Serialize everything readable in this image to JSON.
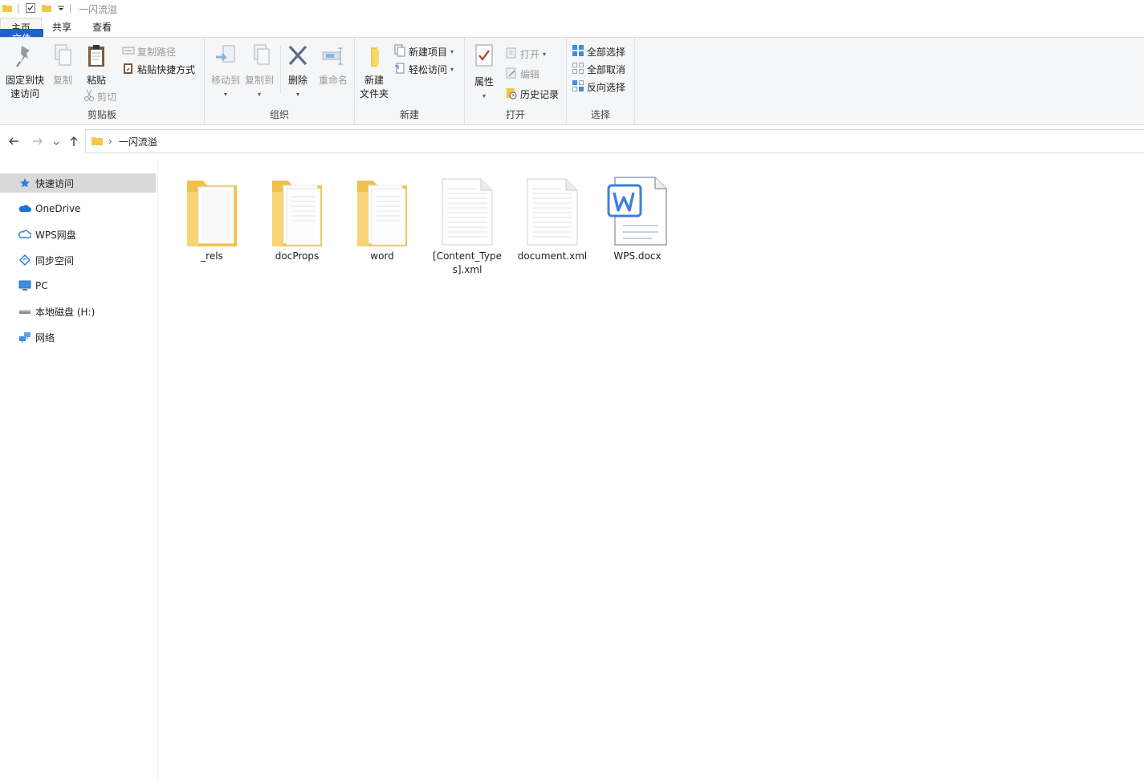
{
  "window": {
    "title": "一闪流溢"
  },
  "tabs": [
    {
      "label": "文件"
    },
    {
      "label": "主页"
    },
    {
      "label": "共享"
    },
    {
      "label": "查看"
    }
  ],
  "ribbon": {
    "clipboard": {
      "group_label": "剪贴板",
      "pin_label_1": "固定到快",
      "pin_label_2": "速访问",
      "copy": "复制",
      "paste": "粘贴",
      "copy_path": "复制路径",
      "paste_shortcut": "粘贴快捷方式",
      "cut": "剪切"
    },
    "organize": {
      "group_label": "组织",
      "move_to": "移动到",
      "copy_to": "复制到",
      "delete": "删除",
      "rename": "重命名"
    },
    "new": {
      "group_label": "新建",
      "new_folder_1": "新建",
      "new_folder_2": "文件夹",
      "new_item": "新建项目",
      "easy_access": "轻松访问"
    },
    "open": {
      "group_label": "打开",
      "properties": "属性",
      "open": "打开",
      "edit": "编辑",
      "history": "历史记录"
    },
    "select": {
      "group_label": "选择",
      "select_all": "全部选择",
      "select_none": "全部取消",
      "invert": "反向选择"
    }
  },
  "address": {
    "path": "一闪流溢"
  },
  "sidebar": {
    "items": [
      {
        "label": "快速访问"
      },
      {
        "label": "OneDrive"
      },
      {
        "label": "WPS网盘"
      },
      {
        "label": "同步空间"
      },
      {
        "label": "PC"
      },
      {
        "label": "本地磁盘 (H:)"
      },
      {
        "label": "网络"
      }
    ]
  },
  "files": [
    {
      "name": "_rels"
    },
    {
      "name": "docProps"
    },
    {
      "name": "word"
    },
    {
      "name": "[Content_Types].xml"
    },
    {
      "name": "document.xml"
    },
    {
      "name": "WPS.docx"
    }
  ]
}
